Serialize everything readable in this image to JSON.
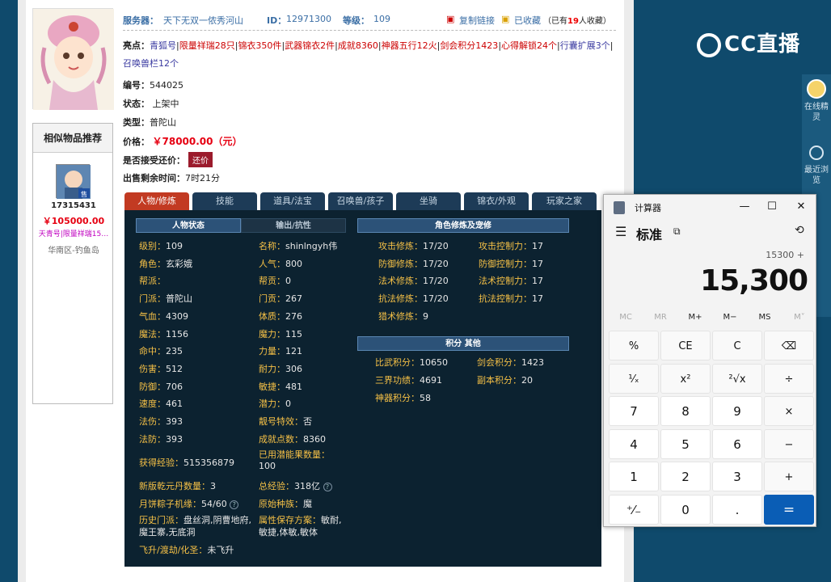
{
  "header": {
    "server_label": "服务器：",
    "server_value": "天下无双一侬秀河山",
    "id_label": "ID：",
    "id_value": "12971300",
    "level_label": "等级：",
    "level_value": "109",
    "copy_link": "复制链接",
    "favorited": "已收藏",
    "fav_prefix": "（已有",
    "fav_count": "19",
    "fav_suffix": "人收藏）"
  },
  "highlights": {
    "label": "亮点：",
    "items": [
      "青狐号",
      "限量祥瑞28只",
      "锦衣350件",
      "武器锦衣2件",
      "成就8360",
      "神器五行12火",
      "剑会积分1423",
      "心得解锁24个",
      "行囊扩展3个",
      "召唤兽栏12个"
    ]
  },
  "info": {
    "number_label": "编号：",
    "number_value": "544025",
    "status_label": "状态：",
    "status_value": "上架中",
    "type_label": "类型：",
    "type_value": "普陀山",
    "price_label": "价格：",
    "price_value": "￥78000.00（元）",
    "bargain_label": "是否接受还价：",
    "bargain_button": "还价",
    "time_label": "出售剩余时间：",
    "time_value": "7时21分"
  },
  "similar": {
    "title": "相似物品推荐",
    "badge": "售",
    "id": "17315431",
    "price": "￥105000.00",
    "desc": "天青号|限量祥瑞15…",
    "area": "华南区-钓鱼岛"
  },
  "tabs": [
    "人物/修炼",
    "技能",
    "道具/法宝",
    "召唤兽/孩子",
    "坐骑",
    "锦衣/外观",
    "玩家之家"
  ],
  "sections": {
    "char_state": "人物状态",
    "output": "输出/抗性",
    "cultivation": "角色修炼及宠修",
    "points": "积分 其他"
  },
  "left_stats": [
    [
      "级别：",
      "109"
    ],
    [
      "角色：",
      "玄彩娥"
    ],
    [
      "帮派：",
      ""
    ],
    [
      "门派：",
      "普陀山"
    ],
    [
      "气血：",
      "4309"
    ],
    [
      "魔法：",
      "1156"
    ],
    [
      "命中：",
      "235"
    ],
    [
      "伤害：",
      "512"
    ],
    [
      "防御：",
      "706"
    ],
    [
      "速度：",
      "461"
    ],
    [
      "法伤：",
      "393"
    ],
    [
      "法防：",
      "393"
    ]
  ],
  "mid_stats": [
    [
      "名称：",
      "shinlngyh伟"
    ],
    [
      "人气：",
      "800"
    ],
    [
      "帮贡：",
      "0"
    ],
    [
      "门贡：",
      "267"
    ],
    [
      "体质：",
      "276"
    ],
    [
      "魔力：",
      "115"
    ],
    [
      "力量：",
      "121"
    ],
    [
      "耐力：",
      "306"
    ],
    [
      "敏捷：",
      "481"
    ],
    [
      "潜力：",
      "0"
    ],
    [
      "靓号特效：",
      "否"
    ],
    [
      "成就点数：",
      "8360"
    ]
  ],
  "extra": {
    "exp_label": "获得经验：",
    "exp_value": "515356879",
    "cores_label": "已用潜能果数量：",
    "cores_value": "100",
    "pill_label": "新版乾元丹数量：",
    "pill_value": "3",
    "total_exp_label": "总经验：",
    "total_exp_value": "318亿",
    "mooncake_label": "月饼粽子机缘：",
    "mooncake_value": "54/60",
    "race_label": "原始种族：",
    "race_value": "魔",
    "history_label": "历史门派：",
    "history_value": "盘丝洞,阴曹地府,魔王寨,无底洞",
    "attr_label": "属性保存方案：",
    "attr_value": "敏耐,敏捷,体敏,敏体",
    "ascend_label": "飞升/渡劫/化圣：",
    "ascend_value": "未飞升"
  },
  "cultivation": [
    [
      "攻击修炼：",
      "17/20",
      "攻击控制力：",
      "17"
    ],
    [
      "防御修炼：",
      "17/20",
      "防御控制力：",
      "17"
    ],
    [
      "法术修炼：",
      "17/20",
      "法术控制力：",
      "17"
    ],
    [
      "抗法修炼：",
      "17/20",
      "抗法控制力：",
      "17"
    ],
    [
      "猎术修炼：",
      "9",
      "",
      ""
    ]
  ],
  "points": [
    [
      "比武积分：",
      "10650",
      "剑会积分：",
      "1423"
    ],
    [
      "三界功绩：",
      "4691",
      "副本积分：",
      "20"
    ],
    [
      "神器积分：",
      "58",
      "",
      ""
    ]
  ],
  "cc": {
    "logo": "CC直播",
    "tools": [
      "在线精灵",
      "最近浏览"
    ]
  },
  "calculator": {
    "title": "计算器",
    "mode": "标准",
    "expression": "15300 +",
    "display": "15,300",
    "memory": [
      "MC",
      "MR",
      "M+",
      "M−",
      "MS",
      "M˅"
    ],
    "keys": [
      "%",
      "CE",
      "C",
      "⌫",
      "¹⁄ₓ",
      "x²",
      "²√x",
      "÷",
      "7",
      "8",
      "9",
      "×",
      "4",
      "5",
      "6",
      "−",
      "1",
      "2",
      "3",
      "+",
      "⁺⁄₋",
      "0",
      ".",
      "="
    ]
  }
}
